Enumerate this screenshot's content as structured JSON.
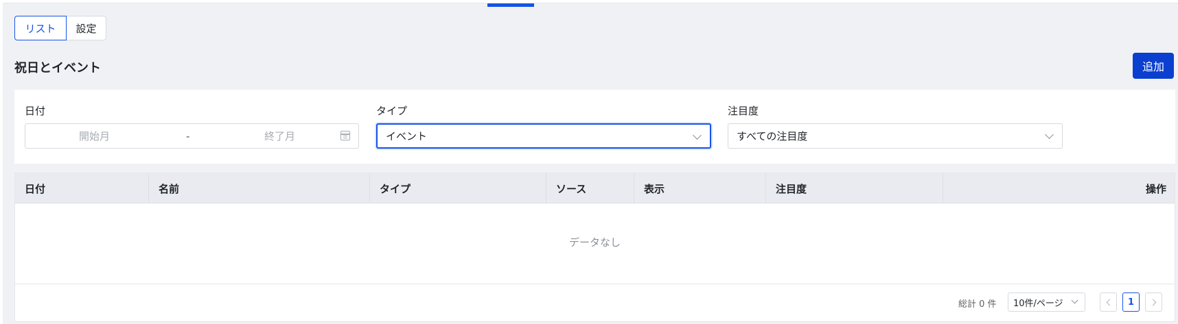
{
  "tabs": [
    {
      "label": "リスト",
      "active": true
    },
    {
      "label": "設定",
      "active": false
    }
  ],
  "page_title": "祝日とイベント",
  "add_button_label": "追加",
  "filters": {
    "date": {
      "label": "日付",
      "start_placeholder": "開始月",
      "separator": "-",
      "end_placeholder": "終了月",
      "icon": "calendar-icon"
    },
    "type": {
      "label": "タイプ",
      "value": "イベント",
      "icon": "chevron-down-icon"
    },
    "attention": {
      "label": "注目度",
      "value": "すべての注目度",
      "icon": "chevron-down-icon"
    }
  },
  "table": {
    "columns": [
      "日付",
      "名前",
      "タイプ",
      "ソース",
      "表示",
      "注目度",
      "操作"
    ],
    "empty_text": "データなし"
  },
  "pagination": {
    "total_text": "総計 0 件",
    "page_size": "10件/ページ",
    "current_page": "1",
    "prev_icon": "chevron-left-icon",
    "next_icon": "chevron-right-icon"
  },
  "colors": {
    "accent": "#1453e6",
    "primary_button": "#0b3fd0",
    "background": "#f0f1f5"
  }
}
